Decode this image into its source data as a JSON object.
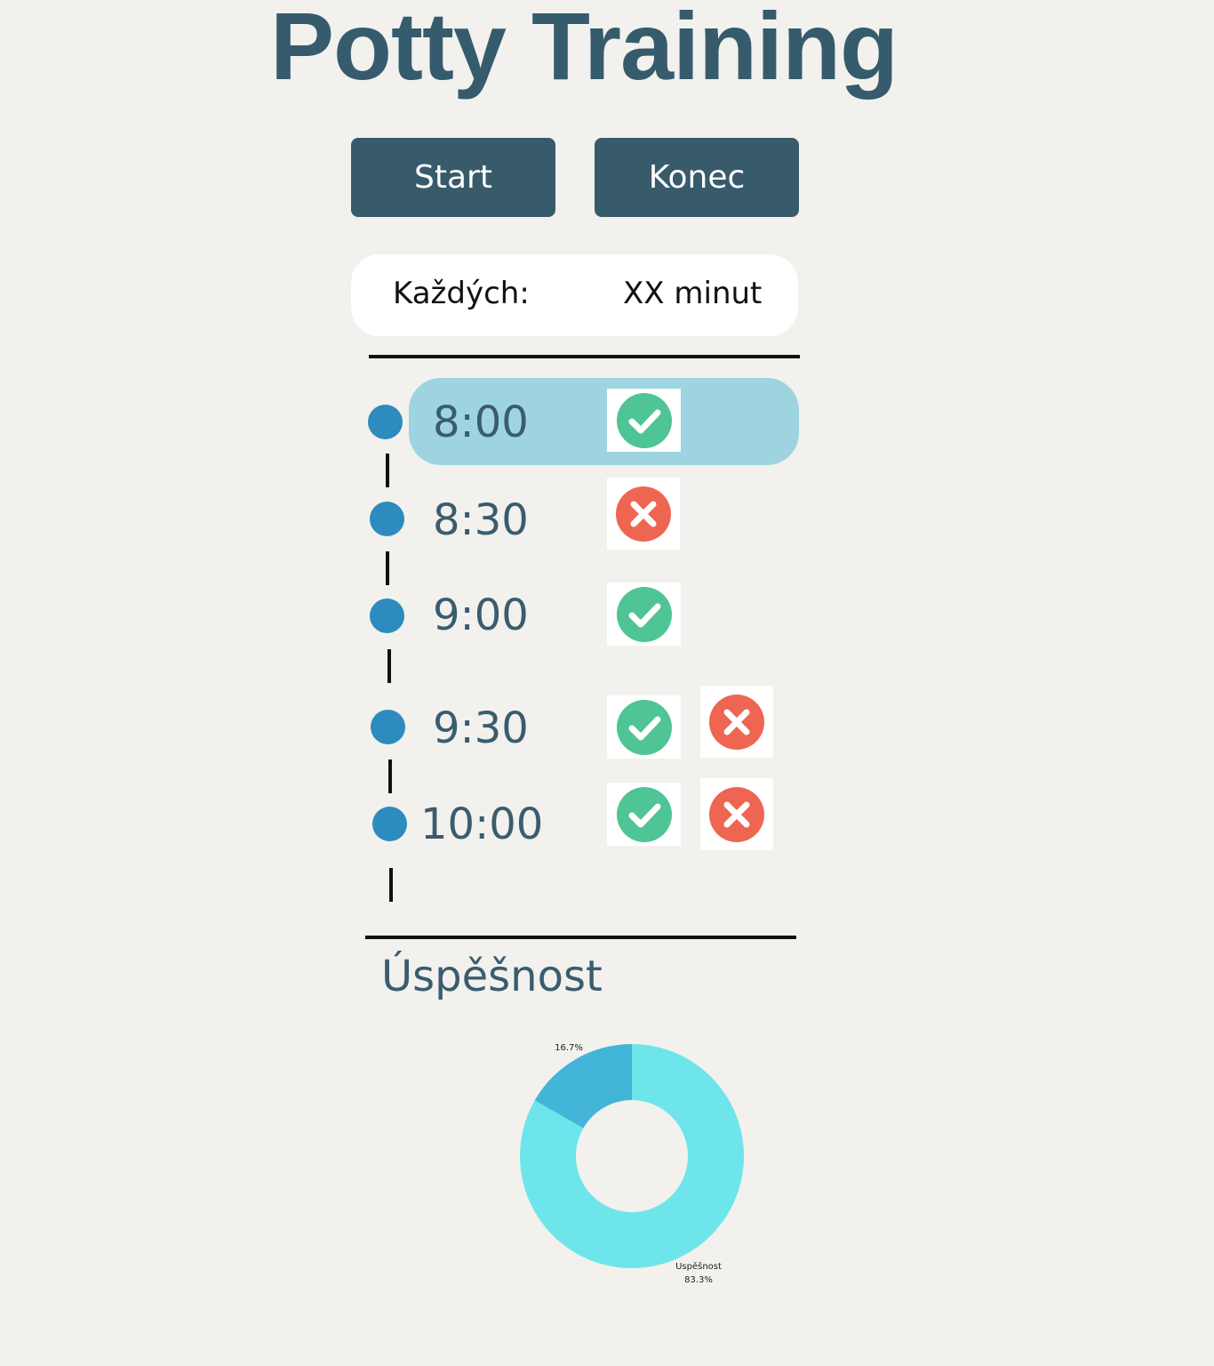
{
  "title": "Potty Training",
  "buttons": {
    "start": "Start",
    "end": "Konec"
  },
  "interval": {
    "label": "Každých:",
    "value": "XX minut"
  },
  "schedule": [
    {
      "time": "8:00",
      "results": [
        "success"
      ],
      "highlighted": true
    },
    {
      "time": "8:30",
      "results": [
        "fail"
      ]
    },
    {
      "time": "9:00",
      "results": [
        "success"
      ]
    },
    {
      "time": "9:30",
      "results": [
        "success",
        "fail"
      ]
    },
    {
      "time": "10:00",
      "results": [
        "success",
        "fail"
      ]
    }
  ],
  "icons": {
    "success": "check-circle-icon",
    "fail": "x-circle-icon"
  },
  "colors": {
    "title": "#365b6d",
    "button": "#385b6c",
    "dot": "#2d8bbd",
    "highlight": "#9dd4e0",
    "success": "#4fc495",
    "fail": "#ee6551"
  },
  "stats": {
    "title": "Úspěšnost"
  },
  "chart_data": {
    "type": "pie",
    "donut": true,
    "slices": [
      {
        "label": "Uspěšnost",
        "value": 83.3,
        "display": "83.3%",
        "color": "#6ee5ea"
      },
      {
        "label": "",
        "value": 16.7,
        "display": "16.7%",
        "color": "#42b5d8"
      }
    ]
  }
}
